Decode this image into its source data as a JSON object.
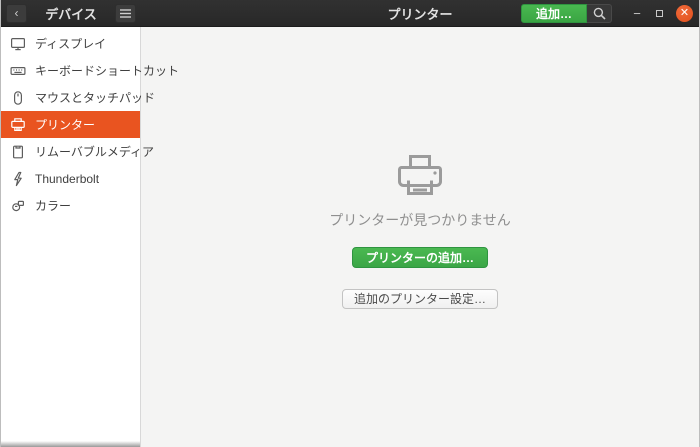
{
  "header": {
    "back_glyph": "‹",
    "sidebar_title": "デバイス",
    "page_title": "プリンター",
    "add_button_label": "追加…",
    "window_controls": {
      "minimize": "−",
      "close": "✕"
    }
  },
  "sidebar": {
    "items": [
      {
        "label": "ディスプレイ",
        "icon": "display-icon",
        "selected": false
      },
      {
        "label": "キーボードショートカット",
        "icon": "keyboard-icon",
        "selected": false
      },
      {
        "label": "マウスとタッチパッド",
        "icon": "mouse-icon",
        "selected": false
      },
      {
        "label": "プリンター",
        "icon": "printer-icon",
        "selected": true
      },
      {
        "label": "リムーバブルメディア",
        "icon": "removable-media-icon",
        "selected": false
      },
      {
        "label": "Thunderbolt",
        "icon": "thunderbolt-icon",
        "selected": false
      },
      {
        "label": "カラー",
        "icon": "color-icon",
        "selected": false
      }
    ]
  },
  "main": {
    "empty_title": "プリンターが見つかりません",
    "add_printer_button": "プリンターの追加…",
    "additional_settings_button": "追加のプリンター設定…"
  },
  "colors": {
    "accent_orange": "#E95420",
    "suggested_green": "#3BA646",
    "header_bg": "#2c2c2c",
    "main_bg": "#f4f4f3",
    "sidebar_bg": "#ffffff"
  }
}
